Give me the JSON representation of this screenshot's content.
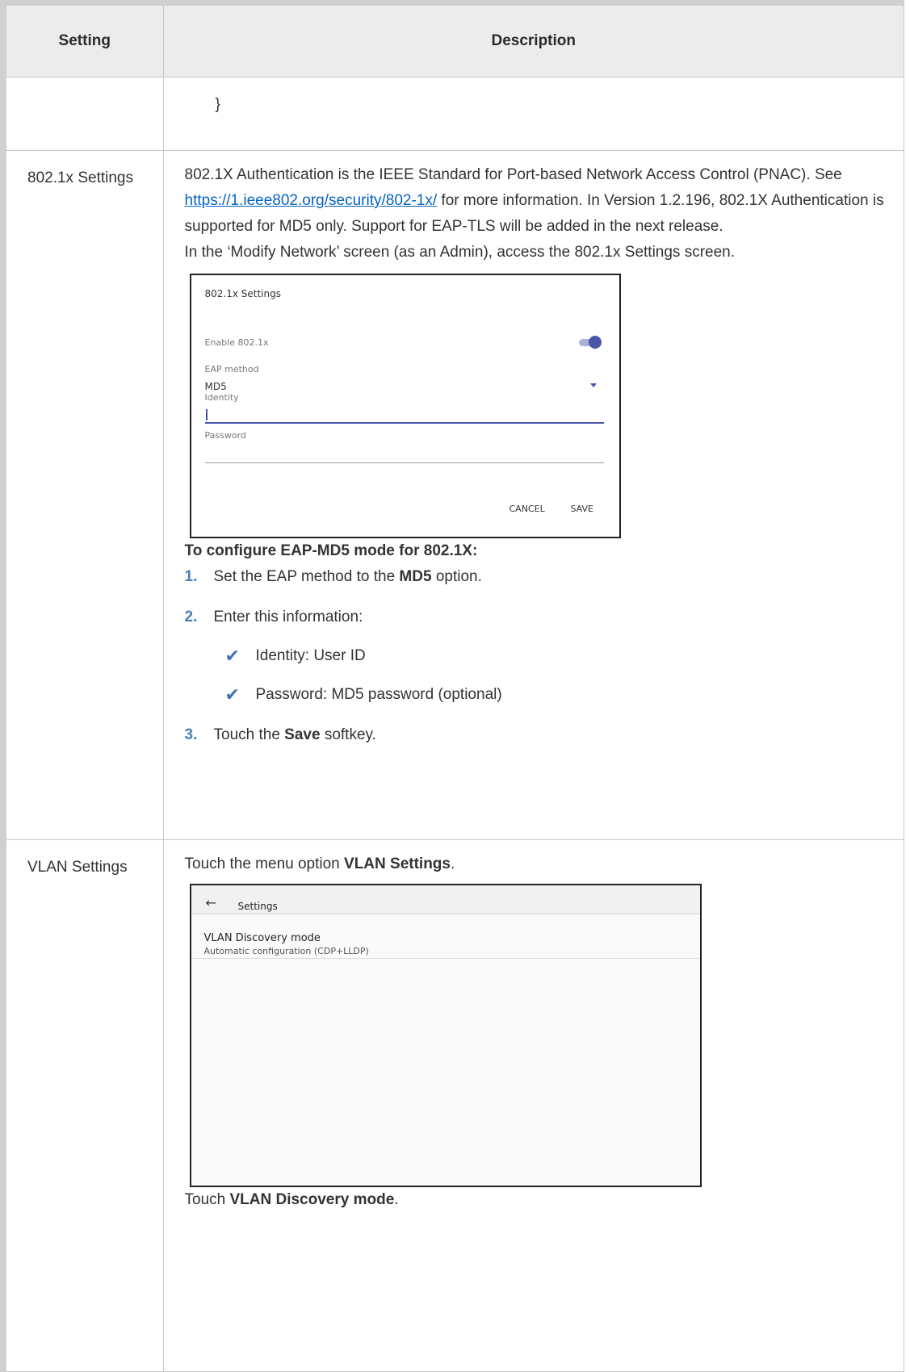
{
  "table": {
    "headers": [
      "Setting",
      "Description"
    ],
    "brace_row": {
      "setting": "",
      "text": "}"
    },
    "dot1x_row": {
      "setting": "802.1x Settings",
      "para1_a": "802.1X Authentication is the IEEE Standard for Port-based Network Access Control (PNAC). See ",
      "link": "https://1.ieee802.org/security/802-1x/",
      "para1_b": " for more information. In Version 1.2.196, 802.1X Authentication is supported for MD5 only. Support for EAP-TLS will be added in the next release.",
      "para2": "In the ‘Modify Network’ screen (as an Admin), access the 802.1x Settings screen.",
      "screenshot": {
        "title": "802.1x Settings",
        "enable_label": "Enable 802.1x",
        "enable_state": true,
        "eap_label": "EAP method",
        "eap_value": "MD5",
        "identity_label": "Identity",
        "password_label": "Password",
        "cancel": "CANCEL",
        "save": "SAVE"
      },
      "procedure_title": "To configure EAP-MD5 mode for 802.1X:",
      "step1_num": "1.",
      "step1_a": "Set the EAP method to the ",
      "step1_b": "MD5",
      "step1_c": " option.",
      "step2_num": "2.",
      "step2": "Enter this information:",
      "check1": "Identity: User ID",
      "check2": "Password: MD5 password (optional)",
      "step3_num": "3.",
      "step3_a": "Touch the ",
      "step3_b": "Save",
      "step3_c": " softkey."
    },
    "vlan_row": {
      "setting": "VLAN Settings",
      "intro_a": "Touch the menu option ",
      "intro_b": "VLAN Settings",
      "intro_c": ".",
      "screenshot": {
        "back_icon": "←",
        "title": "Settings",
        "item_title": "VLAN Discovery mode",
        "item_sub": "Automatic configuration (CDP+LLDP)"
      },
      "outro_a": "Touch ",
      "outro_b": "VLAN Discovery mode",
      "outro_c": "."
    }
  },
  "colors": {
    "link": "#0563c1",
    "step_number": "#4c7fb3",
    "checkmark": "#3f73b6",
    "toggle": "#4a56a8"
  },
  "icons": {
    "checkmark": "✔"
  }
}
